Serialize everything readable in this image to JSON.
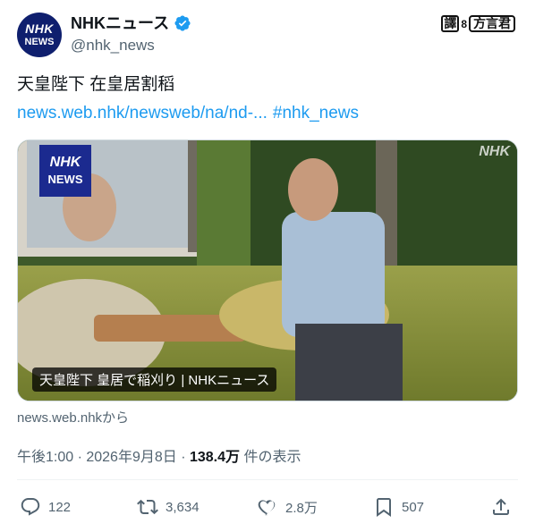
{
  "author": {
    "avatar_top": "NHK",
    "avatar_bottom": "NEWS",
    "display_name": "NHKニュース",
    "handle": "@nhk_news",
    "verified_icon": "verified-badge-icon"
  },
  "translate_badge": {
    "kanji": "譯",
    "dot": "8",
    "label": "方言君"
  },
  "tweet": {
    "text": "天皇陛下 在皇居割稻",
    "link": "news.web.nhk/newsweb/na/nd-...",
    "hashtag": "#nhk_news"
  },
  "media": {
    "logo_top": "NHK",
    "logo_bottom": "NEWS",
    "watermark": "NHK",
    "caption": "天皇陛下 皇居で稲刈り | NHKニュース"
  },
  "source": "news.web.nhkから",
  "meta": {
    "time_date": "午後1:00 · 2026年9月8日 · ",
    "views": "138.4万",
    "views_suffix": " 件の表示"
  },
  "actions": {
    "reply": "122",
    "retweet": "3,634",
    "like": "2.8万",
    "bookmark": "507"
  },
  "colors": {
    "link": "#1d9bf0",
    "secondary": "#536471",
    "nhk_blue": "#1b2a8f"
  }
}
